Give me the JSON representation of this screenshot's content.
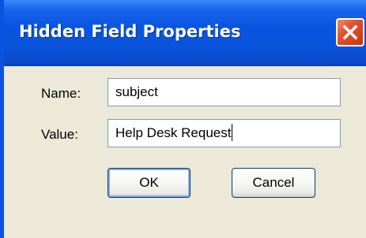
{
  "dialog": {
    "title": "Hidden Field Properties",
    "close_icon": "close-icon"
  },
  "form": {
    "name_label": "Name:",
    "name_value": "subject",
    "value_label": "Value:",
    "value_value": "Help Desk Request"
  },
  "buttons": {
    "ok_label": "OK",
    "cancel_label": "Cancel"
  },
  "colors": {
    "titlebar": "#0a55e0",
    "window_body": "#ece9d8",
    "close_button": "#e0512d"
  }
}
